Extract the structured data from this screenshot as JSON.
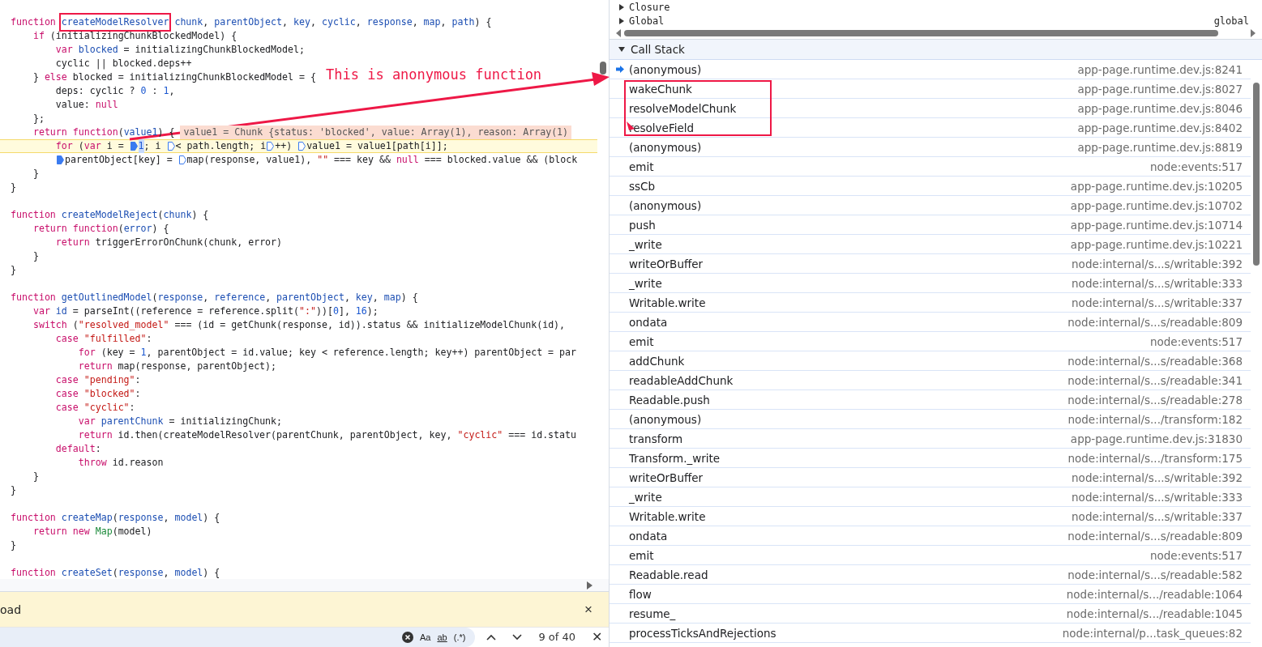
{
  "editor": {
    "lines": [
      {
        "current": false,
        "tokens": [
          {
            "kind": "kw",
            "text": "function"
          },
          {
            "kind": "def-boxed",
            "text": "createModelResolver"
          },
          {
            "kind": "def",
            "text": "chunk"
          },
          {
            "kind": "plain",
            "text": ", "
          },
          {
            "kind": "def",
            "text": "parentObject"
          },
          {
            "kind": "plain",
            "text": ", "
          },
          {
            "kind": "def",
            "text": "key"
          },
          {
            "kind": "plain",
            "text": ", "
          },
          {
            "kind": "def",
            "text": "cyclic"
          },
          {
            "kind": "plain",
            "text": ", "
          },
          {
            "kind": "def",
            "text": "response"
          },
          {
            "kind": "plain",
            "text": ", "
          },
          {
            "kind": "def",
            "text": "map"
          },
          {
            "kind": "plain",
            "text": ", "
          },
          {
            "kind": "def",
            "text": "path"
          },
          {
            "kind": "plain",
            "text": ") {"
          }
        ]
      },
      {
        "current": false,
        "tokens": [
          {
            "kind": "kw",
            "text": "    if"
          },
          {
            "kind": "plain",
            "text": " (initializingChunkBlockedModel) {"
          }
        ]
      },
      {
        "current": false,
        "tokens": [
          {
            "kind": "kw",
            "text": "        var"
          },
          {
            "kind": "def",
            "text": " blocked"
          },
          {
            "kind": "plain",
            "text": " = initializingChunkBlockedModel;"
          }
        ]
      },
      {
        "current": false,
        "tokens": [
          {
            "kind": "plain",
            "text": "        cyclic || blocked.deps++"
          }
        ]
      },
      {
        "current": false,
        "tokens": [
          {
            "kind": "plain",
            "text": "    } "
          },
          {
            "kind": "kw",
            "text": "else"
          },
          {
            "kind": "plain",
            "text": " blocked = initializingChunkBlockedModel = {"
          }
        ]
      },
      {
        "current": false,
        "tokens": [
          {
            "kind": "plain",
            "text": "        deps: cyclic ? "
          },
          {
            "kind": "num",
            "text": "0"
          },
          {
            "kind": "plain",
            "text": " : "
          },
          {
            "kind": "num",
            "text": "1"
          },
          {
            "kind": "plain",
            "text": ","
          }
        ]
      },
      {
        "current": false,
        "tokens": [
          {
            "kind": "plain",
            "text": "        value: "
          },
          {
            "kind": "kw",
            "text": "null"
          }
        ]
      },
      {
        "current": false,
        "tokens": [
          {
            "kind": "plain",
            "text": "    };"
          }
        ]
      },
      {
        "current": false,
        "tokens": [
          {
            "kind": "kw",
            "text": "    return"
          },
          {
            "kind": "kw",
            "text": " function"
          },
          {
            "kind": "plain",
            "text": "("
          },
          {
            "kind": "def",
            "text": "value1"
          },
          {
            "kind": "plain",
            "text": ") {"
          },
          {
            "kind": "inline",
            "text": "value1 = Chunk {status: 'blocked', value: Array(1), reason: Array(1)"
          }
        ]
      },
      {
        "current": true,
        "tokens": [
          {
            "kind": "kw",
            "text": "        for"
          },
          {
            "kind": "plain",
            "text": " ("
          },
          {
            "kind": "kw",
            "text": "var"
          },
          {
            "kind": "plain",
            "text": " i = "
          },
          {
            "kind": "stop",
            "active": true
          },
          {
            "kind": "hl",
            "text": "1"
          },
          {
            "kind": "plain",
            "text": "; i "
          },
          {
            "kind": "stop",
            "active": false
          },
          {
            "kind": "plain",
            "text": "< path.length; i"
          },
          {
            "kind": "stop",
            "active": false
          },
          {
            "kind": "plain",
            "text": "++) "
          },
          {
            "kind": "stop",
            "active": false
          },
          {
            "kind": "plain",
            "text": "value1 = value1[path[i]];"
          }
        ]
      },
      {
        "current": false,
        "tokens": [
          {
            "kind": "stop",
            "active": true
          },
          {
            "kind": "plain",
            "text": "parentObject[key] = "
          },
          {
            "kind": "stop",
            "active": false
          },
          {
            "kind": "plain",
            "text": "map(response, value1), "
          },
          {
            "kind": "str",
            "text": "\"\""
          },
          {
            "kind": "plain",
            "text": " === key && "
          },
          {
            "kind": "kw",
            "text": "null"
          },
          {
            "kind": "plain",
            "text": " === blocked.value && (block"
          }
        ]
      },
      {
        "current": false,
        "tokens": [
          {
            "kind": "plain",
            "text": "    }"
          }
        ]
      },
      {
        "current": false,
        "tokens": [
          {
            "kind": "plain",
            "text": "}"
          }
        ]
      },
      {
        "current": false
      },
      {
        "current": false,
        "tokens": [
          {
            "kind": "kw",
            "text": "function"
          },
          {
            "kind": "def",
            "text": " createModelReject"
          },
          {
            "kind": "plain",
            "text": "("
          },
          {
            "kind": "def",
            "text": "chunk"
          },
          {
            "kind": "plain",
            "text": ") {"
          }
        ]
      },
      {
        "current": false,
        "tokens": [
          {
            "kind": "kw",
            "text": "    return"
          },
          {
            "kind": "kw",
            "text": " function"
          },
          {
            "kind": "plain",
            "text": "("
          },
          {
            "kind": "def",
            "text": "error"
          },
          {
            "kind": "plain",
            "text": ") {"
          }
        ]
      },
      {
        "current": false,
        "tokens": [
          {
            "kind": "kw",
            "text": "        return"
          },
          {
            "kind": "plain",
            "text": " triggerErrorOnChunk(chunk, error)"
          }
        ]
      },
      {
        "current": false,
        "tokens": [
          {
            "kind": "plain",
            "text": "    }"
          }
        ]
      },
      {
        "current": false,
        "tokens": [
          {
            "kind": "plain",
            "text": "}"
          }
        ]
      },
      {
        "current": false
      },
      {
        "current": false,
        "tokens": [
          {
            "kind": "kw",
            "text": "function"
          },
          {
            "kind": "def",
            "text": " getOutlinedModel"
          },
          {
            "kind": "plain",
            "text": "("
          },
          {
            "kind": "def",
            "text": "response"
          },
          {
            "kind": "plain",
            "text": ", "
          },
          {
            "kind": "def",
            "text": "reference"
          },
          {
            "kind": "plain",
            "text": ", "
          },
          {
            "kind": "def",
            "text": "parentObject"
          },
          {
            "kind": "plain",
            "text": ", "
          },
          {
            "kind": "def",
            "text": "key"
          },
          {
            "kind": "plain",
            "text": ", "
          },
          {
            "kind": "def",
            "text": "map"
          },
          {
            "kind": "plain",
            "text": ") {"
          }
        ]
      },
      {
        "current": false,
        "tokens": [
          {
            "kind": "kw",
            "text": "    var"
          },
          {
            "kind": "def",
            "text": " id"
          },
          {
            "kind": "plain",
            "text": " = parseInt((reference = reference.split("
          },
          {
            "kind": "str",
            "text": "\":\""
          },
          {
            "kind": "plain",
            "text": "))["
          },
          {
            "kind": "num",
            "text": "0"
          },
          {
            "kind": "plain",
            "text": "], "
          },
          {
            "kind": "num",
            "text": "16"
          },
          {
            "kind": "plain",
            "text": ");"
          }
        ]
      },
      {
        "current": false,
        "tokens": [
          {
            "kind": "kw",
            "text": "    switch"
          },
          {
            "kind": "plain",
            "text": " ("
          },
          {
            "kind": "str",
            "text": "\"resolved_model\""
          },
          {
            "kind": "plain",
            "text": " === (id = getChunk(response, id)).status && initializeModelChunk(id),"
          }
        ]
      },
      {
        "current": false,
        "tokens": [
          {
            "kind": "kw",
            "text": "        case"
          },
          {
            "kind": "str",
            "text": " \"fulfilled\""
          },
          {
            "kind": "plain",
            "text": ":"
          }
        ]
      },
      {
        "current": false,
        "tokens": [
          {
            "kind": "kw",
            "text": "            for"
          },
          {
            "kind": "plain",
            "text": " (key = "
          },
          {
            "kind": "num",
            "text": "1"
          },
          {
            "kind": "plain",
            "text": ", parentObject = id.value; key < reference.length; key++) parentObject = par"
          }
        ]
      },
      {
        "current": false,
        "tokens": [
          {
            "kind": "kw",
            "text": "            return"
          },
          {
            "kind": "plain",
            "text": " map(response, parentObject);"
          }
        ]
      },
      {
        "current": false,
        "tokens": [
          {
            "kind": "kw",
            "text": "        case"
          },
          {
            "kind": "str",
            "text": " \"pending\""
          },
          {
            "kind": "plain",
            "text": ":"
          }
        ]
      },
      {
        "current": false,
        "tokens": [
          {
            "kind": "kw",
            "text": "        case"
          },
          {
            "kind": "str",
            "text": " \"blocked\""
          },
          {
            "kind": "plain",
            "text": ":"
          }
        ]
      },
      {
        "current": false,
        "tokens": [
          {
            "kind": "kw",
            "text": "        case"
          },
          {
            "kind": "str",
            "text": " \"cyclic\""
          },
          {
            "kind": "plain",
            "text": ":"
          }
        ]
      },
      {
        "current": false,
        "tokens": [
          {
            "kind": "kw",
            "text": "            var"
          },
          {
            "kind": "def",
            "text": " parentChunk"
          },
          {
            "kind": "plain",
            "text": " = initializingChunk;"
          }
        ]
      },
      {
        "current": false,
        "tokens": [
          {
            "kind": "kw",
            "text": "            return"
          },
          {
            "kind": "plain",
            "text": " id.then(createModelResolver(parentChunk, parentObject, key, "
          },
          {
            "kind": "str",
            "text": "\"cyclic\""
          },
          {
            "kind": "plain",
            "text": " === id.statu"
          }
        ]
      },
      {
        "current": false,
        "tokens": [
          {
            "kind": "kw",
            "text": "        default"
          },
          {
            "kind": "plain",
            "text": ":"
          }
        ]
      },
      {
        "current": false,
        "tokens": [
          {
            "kind": "kw",
            "text": "            throw"
          },
          {
            "kind": "plain",
            "text": " id.reason"
          }
        ]
      },
      {
        "current": false,
        "tokens": [
          {
            "kind": "plain",
            "text": "    }"
          }
        ]
      },
      {
        "current": false,
        "tokens": [
          {
            "kind": "plain",
            "text": "}"
          }
        ]
      },
      {
        "current": false
      },
      {
        "current": false,
        "tokens": [
          {
            "kind": "kw",
            "text": "function"
          },
          {
            "kind": "def",
            "text": " createMap"
          },
          {
            "kind": "plain",
            "text": "("
          },
          {
            "kind": "def",
            "text": "response"
          },
          {
            "kind": "plain",
            "text": ", "
          },
          {
            "kind": "def",
            "text": "model"
          },
          {
            "kind": "plain",
            "text": ") {"
          }
        ]
      },
      {
        "current": false,
        "tokens": [
          {
            "kind": "kw",
            "text": "    return"
          },
          {
            "kind": "kw",
            "text": " new"
          },
          {
            "kind": "cls",
            "text": " Map"
          },
          {
            "kind": "plain",
            "text": "(model)"
          }
        ]
      },
      {
        "current": false,
        "tokens": [
          {
            "kind": "plain",
            "text": "}"
          }
        ]
      },
      {
        "current": false
      },
      {
        "current": false,
        "tokens": [
          {
            "kind": "kw",
            "text": "function"
          },
          {
            "kind": "def",
            "text": " createSet"
          },
          {
            "kind": "plain",
            "text": "("
          },
          {
            "kind": "def",
            "text": "response"
          },
          {
            "kind": "plain",
            "text": ", "
          },
          {
            "kind": "def",
            "text": "model"
          },
          {
            "kind": "plain",
            "text": ") {"
          }
        ]
      }
    ]
  },
  "notice": {
    "text": "oad",
    "close": "×"
  },
  "search": {
    "match_case": "Aa",
    "whole_word": "ab",
    "regex": "(.*)",
    "count": "9 of 40",
    "close": "✕"
  },
  "scope": [
    {
      "name": "Closure",
      "expanded": false
    },
    {
      "name": "Global",
      "expanded": false,
      "value": "global"
    }
  ],
  "call_stack": {
    "title": "Call Stack",
    "expanded": true,
    "frames": [
      {
        "name": "(anonymous)",
        "location": "app-page.runtime.dev.js:8241",
        "current": true,
        "annotated": false
      },
      {
        "name": "wakeChunk",
        "location": "app-page.runtime.dev.js:8027",
        "current": false,
        "annotated": true
      },
      {
        "name": "resolveModelChunk",
        "location": "app-page.runtime.dev.js:8046",
        "current": false,
        "annotated": true
      },
      {
        "name": "resolveField",
        "location": "app-page.runtime.dev.js:8402",
        "current": false,
        "annotated": true
      },
      {
        "name": "(anonymous)",
        "location": "app-page.runtime.dev.js:8819",
        "current": false,
        "annotated": false
      },
      {
        "name": "emit",
        "location": "node:events:517",
        "current": false,
        "annotated": false
      },
      {
        "name": "ssCb",
        "location": "app-page.runtime.dev.js:10205",
        "current": false,
        "annotated": false
      },
      {
        "name": "(anonymous)",
        "location": "app-page.runtime.dev.js:10702",
        "current": false,
        "annotated": false
      },
      {
        "name": "push",
        "location": "app-page.runtime.dev.js:10714",
        "current": false,
        "annotated": false
      },
      {
        "name": "_write",
        "location": "app-page.runtime.dev.js:10221",
        "current": false,
        "annotated": false
      },
      {
        "name": "writeOrBuffer",
        "location": "node:internal/s...s/writable:392",
        "current": false,
        "annotated": false
      },
      {
        "name": "_write",
        "location": "node:internal/s...s/writable:333",
        "current": false,
        "annotated": false
      },
      {
        "name": "Writable.write",
        "location": "node:internal/s...s/writable:337",
        "current": false,
        "annotated": false
      },
      {
        "name": "ondata",
        "location": "node:internal/s...s/readable:809",
        "current": false,
        "annotated": false
      },
      {
        "name": "emit",
        "location": "node:events:517",
        "current": false,
        "annotated": false
      },
      {
        "name": "addChunk",
        "location": "node:internal/s...s/readable:368",
        "current": false,
        "annotated": false
      },
      {
        "name": "readableAddChunk",
        "location": "node:internal/s...s/readable:341",
        "current": false,
        "annotated": false
      },
      {
        "name": "Readable.push",
        "location": "node:internal/s...s/readable:278",
        "current": false,
        "annotated": false
      },
      {
        "name": "(anonymous)",
        "location": "node:internal/s.../transform:182",
        "current": false,
        "annotated": false
      },
      {
        "name": "transform",
        "location": "app-page.runtime.dev.js:31830",
        "current": false,
        "annotated": false
      },
      {
        "name": "Transform._write",
        "location": "node:internal/s.../transform:175",
        "current": false,
        "annotated": false
      },
      {
        "name": "writeOrBuffer",
        "location": "node:internal/s...s/writable:392",
        "current": false,
        "annotated": false
      },
      {
        "name": "_write",
        "location": "node:internal/s...s/writable:333",
        "current": false,
        "annotated": false
      },
      {
        "name": "Writable.write",
        "location": "node:internal/s...s/writable:337",
        "current": false,
        "annotated": false
      },
      {
        "name": "ondata",
        "location": "node:internal/s...s/readable:809",
        "current": false,
        "annotated": false
      },
      {
        "name": "emit",
        "location": "node:events:517",
        "current": false,
        "annotated": false
      },
      {
        "name": "Readable.read",
        "location": "node:internal/s...s/readable:582",
        "current": false,
        "annotated": false
      },
      {
        "name": "flow",
        "location": "node:internal/s.../readable:1064",
        "current": false,
        "annotated": false
      },
      {
        "name": "resume_",
        "location": "node:internal/s.../readable:1045",
        "current": false,
        "annotated": false
      },
      {
        "name": "processTicksAndRejections",
        "location": "node:internal/p...task_queues:82",
        "current": false,
        "annotated": false
      }
    ]
  },
  "annotation": {
    "text": "This is anonymous function"
  }
}
